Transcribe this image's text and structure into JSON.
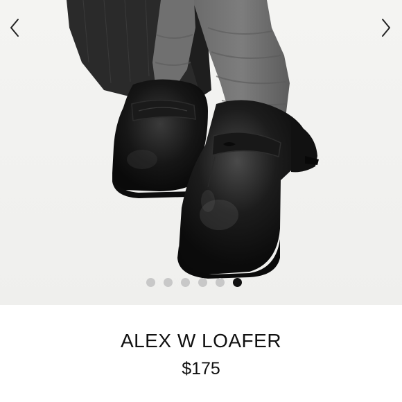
{
  "gallery": {
    "image_description": "product-photo-black-loafers",
    "prev_icon": "chevron-left-icon",
    "next_icon": "chevron-right-icon",
    "dots_total": 6,
    "active_dot_index": 5
  },
  "product": {
    "name": "ALEX W LOAFER",
    "price": "$175"
  }
}
